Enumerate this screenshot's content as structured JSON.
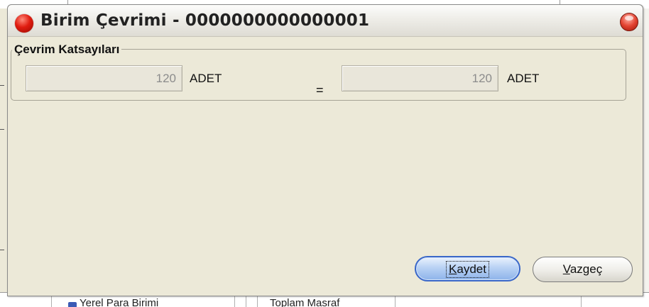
{
  "window": {
    "title": "Birim Çevrimi - 0000000000000001"
  },
  "group": {
    "title": "Çevrim Katsayıları"
  },
  "conversion": {
    "left_value": "120",
    "left_unit": "ADET",
    "equals": "=",
    "right_value": "120",
    "right_unit": "ADET"
  },
  "buttons": {
    "save_mnemonic": "K",
    "save_rest": "aydet",
    "cancel_mnemonic": "V",
    "cancel_rest": "azgeç"
  },
  "background": {
    "fragment_left": "Yerel Para Birimi",
    "fragment_right": "Toplam Masraf"
  },
  "colors": {
    "title_orb": "#e01c10",
    "save_button_border": "#3a67c8",
    "field_bg": "#e9e6da"
  },
  "icons": {
    "window_icon": "red-orb-icon",
    "close": "close-icon"
  }
}
